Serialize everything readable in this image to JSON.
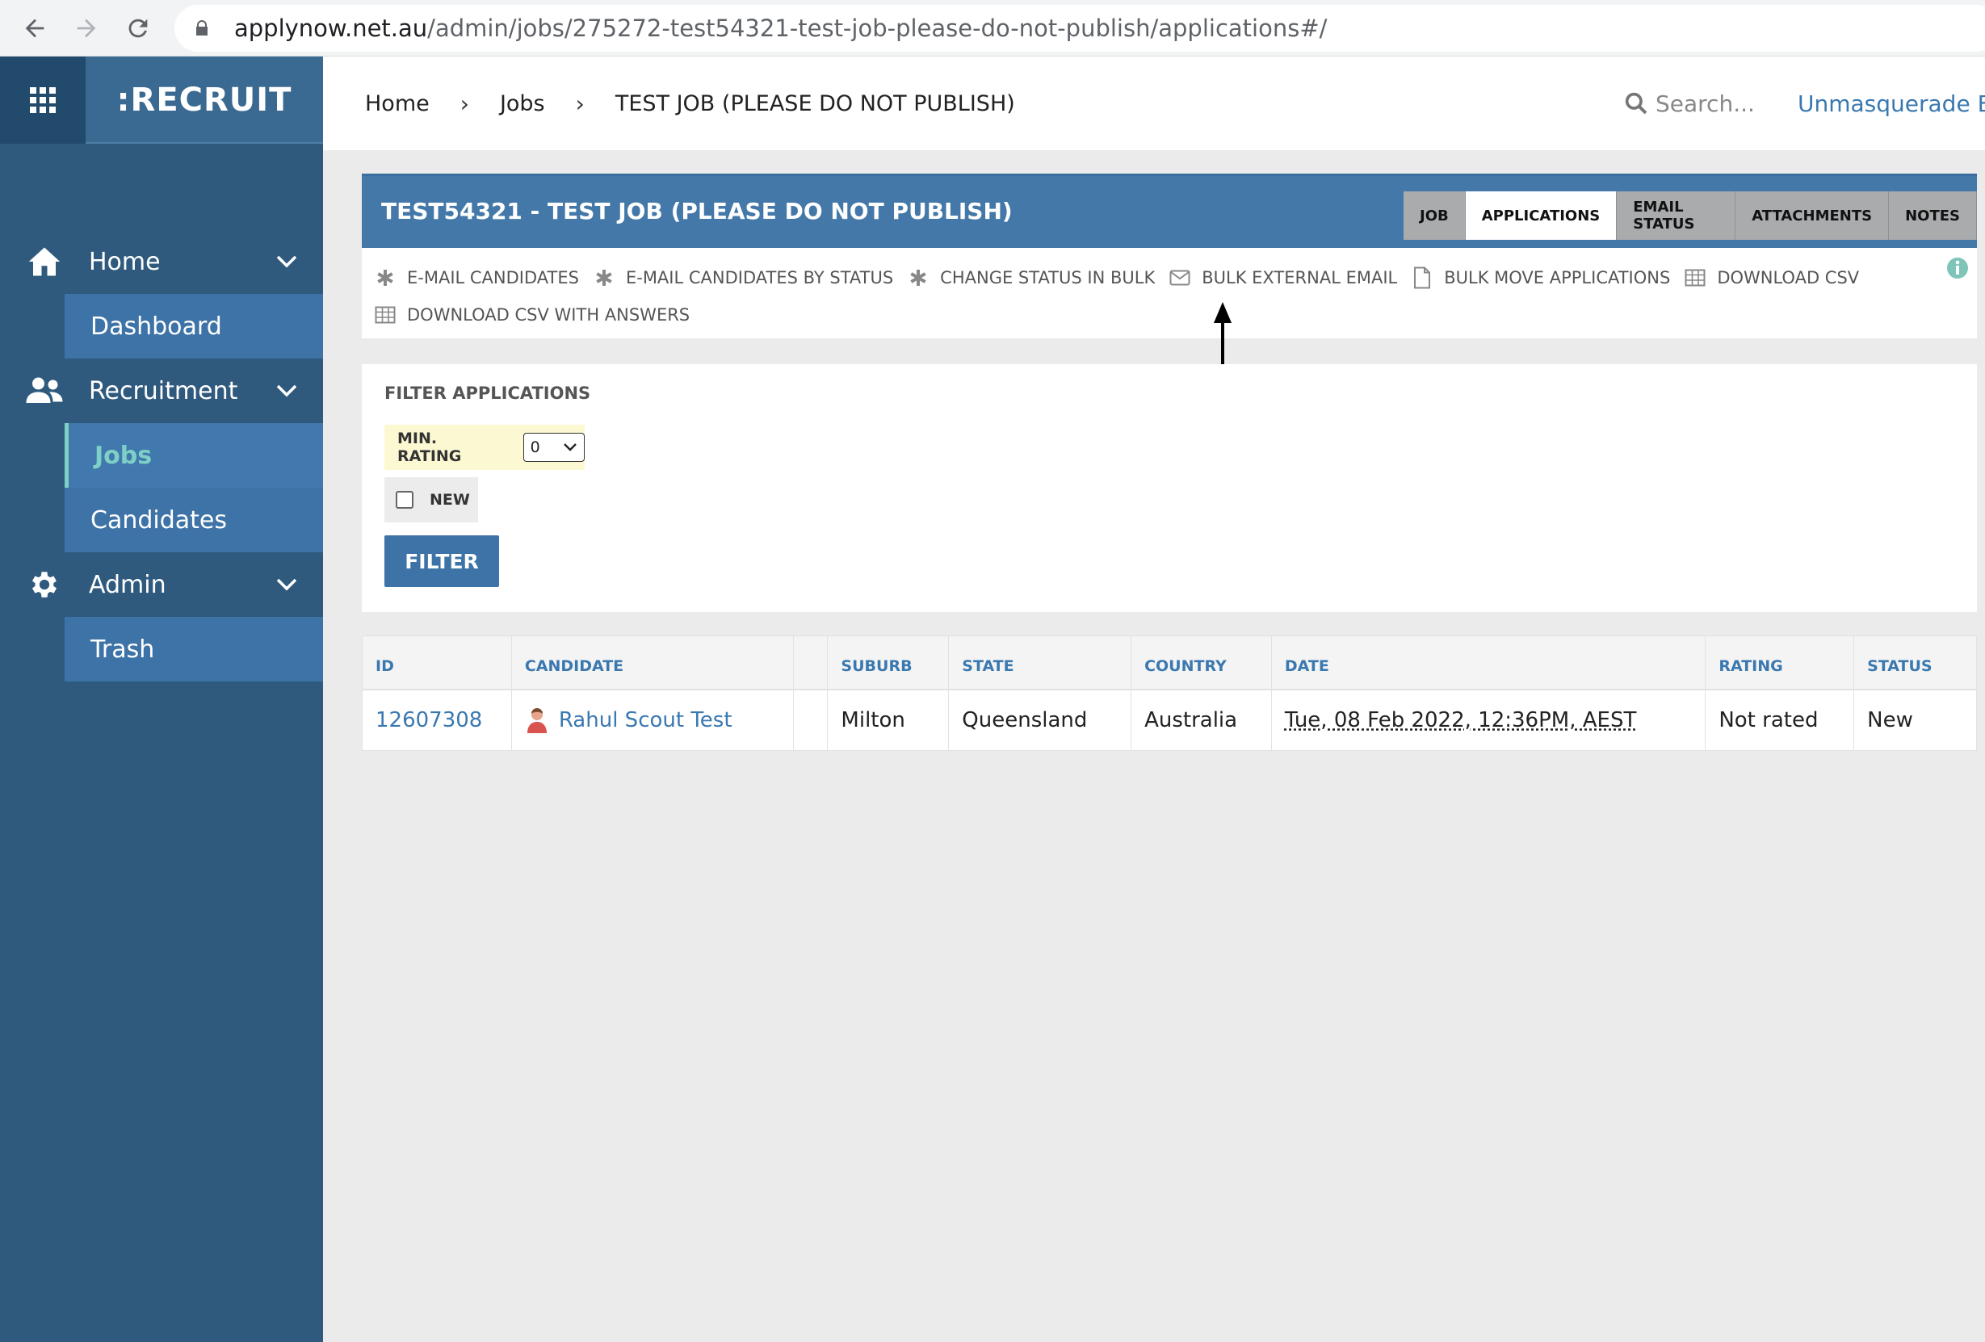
{
  "browser": {
    "url_domain": "applynow.net.au",
    "url_path": "/admin/jobs/275272-test54321-test-job-please-do-not-publish/applications#/",
    "icons": [
      "back-icon",
      "forward-icon",
      "reload-icon",
      "lock-icon"
    ]
  },
  "sidebar": {
    "brand": ":RECRUIT",
    "groups": [
      {
        "label": "Home",
        "icon": "home-icon",
        "items": [
          "Dashboard"
        ]
      },
      {
        "label": "Recruitment",
        "icon": "users-icon",
        "items": [
          "Jobs",
          "Candidates"
        ]
      },
      {
        "label": "Admin",
        "icon": "gear-icon",
        "items": [
          "Trash"
        ]
      }
    ],
    "active_item": "Jobs"
  },
  "header": {
    "breadcrumb": [
      "Home",
      "Jobs",
      "TEST JOB (PLEASE DO NOT PUBLISH)"
    ],
    "search_placeholder": "Search...",
    "unmasquerade": "Unmasquerade Esse"
  },
  "job": {
    "title": "TEST54321 - TEST JOB (PLEASE DO NOT PUBLISH)",
    "tabs": [
      "JOB",
      "APPLICATIONS",
      "EMAIL STATUS",
      "ATTACHMENTS",
      "NOTES"
    ],
    "active_tab": "APPLICATIONS",
    "actions": [
      {
        "label": "E-MAIL CANDIDATES",
        "icon": "asterisk-icon"
      },
      {
        "label": "E-MAIL CANDIDATES BY STATUS",
        "icon": "asterisk-icon"
      },
      {
        "label": "CHANGE STATUS IN BULK",
        "icon": "asterisk-icon"
      },
      {
        "label": "BULK EXTERNAL EMAIL",
        "icon": "envelope-icon"
      },
      {
        "label": "BULK MOVE APPLICATIONS",
        "icon": "file-icon"
      },
      {
        "label": "DOWNLOAD CSV",
        "icon": "table-icon"
      },
      {
        "label": "DOWNLOAD CSV WITH ANSWERS",
        "icon": "table-icon"
      }
    ]
  },
  "filter": {
    "title": "FILTER APPLICATIONS",
    "min_rating_label": "MIN. RATING",
    "min_rating_value": "0",
    "new_label": "NEW",
    "new_checked": false,
    "button": "FILTER"
  },
  "table": {
    "columns": [
      "ID",
      "CANDIDATE",
      "",
      "SUBURB",
      "STATE",
      "COUNTRY",
      "DATE",
      "RATING",
      "STATUS"
    ],
    "rows": [
      {
        "id": "12607308",
        "candidate": "Rahul Scout Test",
        "extra": "",
        "suburb": "Milton",
        "state": "Queensland",
        "country": "Australia",
        "date": "Tue, 08 Feb 2022, 12:36PM, AEST",
        "rating": "Not rated",
        "status": "New"
      }
    ]
  },
  "colors": {
    "sidebar": "#2f5a7e",
    "accent": "#4378a9",
    "link": "#3a78b0",
    "active_nav_text": "#7ed0c6"
  }
}
